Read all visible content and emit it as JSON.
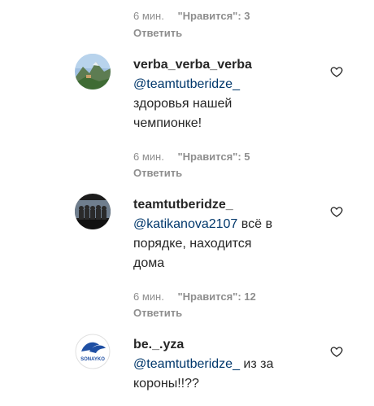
{
  "top_meta": {
    "time": "6 мин.",
    "likes": "\"Нравится\": 3",
    "reply": "Ответить"
  },
  "comments": [
    {
      "username": "verba_verba_verba",
      "mention": "@teamtutberidze_",
      "text_line1": "",
      "text_line2": "здоровья нашей",
      "text_line3": "чемпионке!",
      "time": "6 мин.",
      "likes": "\"Нравится\": 5",
      "reply": "Ответить",
      "avatar_icon": "mountain-landscape-avatar"
    },
    {
      "username": "teamtutberidze_",
      "mention": "@katikanova2107",
      "text_line1": " всё в",
      "text_line2": "порядке, находится",
      "text_line3": "дома",
      "time": "6 мин.",
      "likes": "\"Нравится\": 12",
      "reply": "Ответить",
      "avatar_icon": "team-group-photo-avatar"
    },
    {
      "username": "be._.yza",
      "mention": "@teamtutberidze_",
      "text_line1": " из за",
      "text_line2": "короны!!??",
      "avatar_icon": "sonayko-logo-avatar",
      "avatar_logo_text": "SONAYKO"
    }
  ],
  "icons": {
    "like": "heart-outline-icon"
  },
  "colors": {
    "text": "#262626",
    "secondary": "#8e8e8e",
    "mention": "#00376b",
    "background": "#ffffff"
  }
}
